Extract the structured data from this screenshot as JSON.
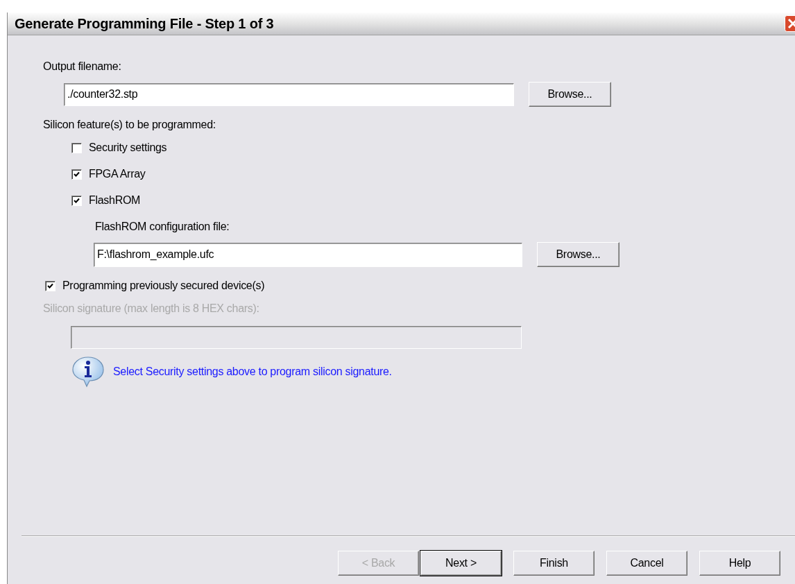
{
  "window": {
    "title": "Generate Programming File - Step 1 of 3"
  },
  "output": {
    "label": "Output filename:",
    "value": "./counter32.stp",
    "button": "Browse..."
  },
  "features": {
    "label": "Silicon feature(s) to be programmed:",
    "options": [
      {
        "label": "Security settings",
        "checked": false
      },
      {
        "label": "FPGA Array",
        "checked": true
      },
      {
        "label": "FlashROM",
        "checked": true
      }
    ]
  },
  "flashrom_config": {
    "label": "FlashROM configuration file:",
    "value": "F:\\flashrom_example.ufc",
    "button": "Browse..."
  },
  "previously_secured": {
    "label": "Programming previously secured device(s)",
    "checked": true
  },
  "signature": {
    "label": "Silicon signature (max length is 8 HEX chars):",
    "disabled": true
  },
  "info": {
    "text": "Select Security settings above to program silicon signature."
  },
  "buttons": [
    {
      "label": "< Back",
      "disabled": true,
      "default": false
    },
    {
      "label": "Next >",
      "disabled": false,
      "default": true
    },
    {
      "label": "Finish",
      "disabled": false,
      "default": false
    },
    {
      "label": "Cancel",
      "disabled": false,
      "default": false
    },
    {
      "label": "Help",
      "disabled": false,
      "default": false
    }
  ]
}
